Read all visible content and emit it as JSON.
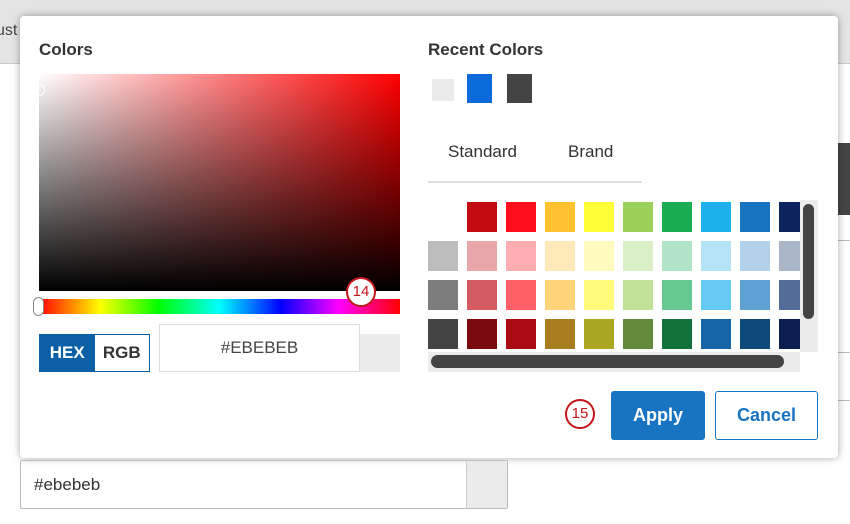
{
  "background": {
    "partial_text": "ust",
    "field_value": "#ebebeb"
  },
  "dialog": {
    "colors_title": "Colors",
    "recent_title": "Recent Colors",
    "recent_colors": [
      "#ebebeb",
      "#0b6ad9",
      "#444444"
    ],
    "picker": {
      "hue_fraction": 0.0,
      "base_hue_color": "#ff0000"
    },
    "format_toggle": {
      "hex_label": "HEX",
      "rgb_label": "RGB",
      "selected": "HEX"
    },
    "hex_value": "#EBEBEB",
    "preview_color": "#ebebeb",
    "tabs": [
      {
        "label": "Standard"
      },
      {
        "label": "Brand"
      }
    ],
    "swatches": [
      [
        "#ffffff",
        "#c20c12",
        "#ff0f1b",
        "#ffc130",
        "#ffff38",
        "#99d15b",
        "#1aad52",
        "#1fb1ed",
        "#1874c0",
        "#0c2560"
      ],
      [
        "#bdbdbd",
        "#e8a6ab",
        "#feaeb3",
        "#feeab8",
        "#fffbbf",
        "#dbefc7",
        "#b2e4c7",
        "#b4e2f6",
        "#b2d1ea",
        "#aab6c8"
      ],
      [
        "#7e7d7d",
        "#d45b60",
        "#ff6167",
        "#fed47b",
        "#fffa7a",
        "#c0e197",
        "#66c98f",
        "#65c9f2",
        "#60a1d3",
        "#536c98"
      ],
      [
        "#444444",
        "#7b0a0e",
        "#a80b12",
        "#a87e20",
        "#aca723",
        "#638a3a",
        "#12733a",
        "#1466a8",
        "#0d4a7b",
        "#0b1e4f"
      ]
    ],
    "apply_label": "Apply",
    "cancel_label": "Cancel",
    "annotations": {
      "hue": "14",
      "apply": "15"
    }
  }
}
